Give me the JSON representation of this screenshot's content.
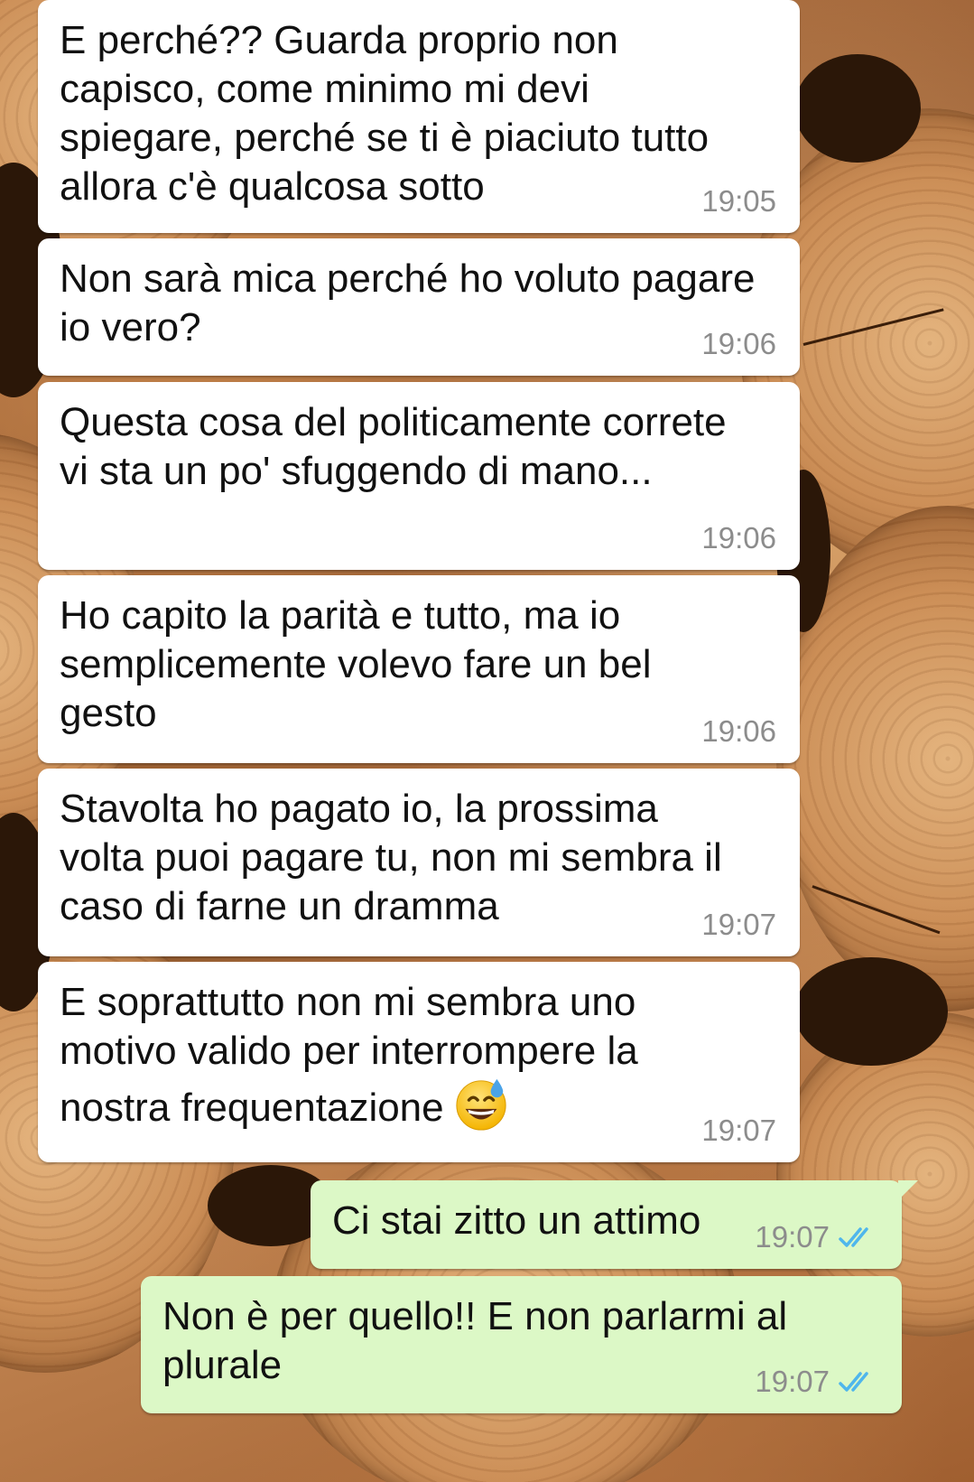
{
  "background": {
    "description_icon": "wood-logs-wallpaper"
  },
  "colors": {
    "incoming_bubble": "#ffffff",
    "outgoing_bubble": "#dcf8c6",
    "timestamp": "#8c8c8c",
    "read_ticks": "#4fb6ec",
    "text": "#111111"
  },
  "messages": [
    {
      "direction": "in",
      "text": "E perché?? Guarda proprio non\ncapisco, come minimo mi devi\nspiegare, perché se ti è piaciuto tutto\nallora c'è qualcosa sotto",
      "time": "19:05"
    },
    {
      "direction": "in",
      "text": "Non sarà mica perché ho voluto pagare\nio vero?",
      "time": "19:06"
    },
    {
      "direction": "in",
      "text": "Questa cosa del politicamente correte\nvi sta un po' sfuggendo di mano...",
      "time": "19:06"
    },
    {
      "direction": "in",
      "text": "Ho capito la parità e tutto, ma io\nsemplicemente volevo fare un bel\ngesto",
      "time": "19:06"
    },
    {
      "direction": "in",
      "text": "Stavolta ho pagato io, la prossima\nvolta puoi pagare tu, non mi sembra il\ncaso di farne un dramma",
      "time": "19:07"
    },
    {
      "direction": "in",
      "text": "E soprattutto non mi sembra uno\nmotivo valido per interrompere la\nnostra frequentazione",
      "emoji": "grinning-face-with-sweat-icon",
      "time": "19:07"
    },
    {
      "direction": "out",
      "text": "Ci stai zitto un attimo",
      "time": "19:07",
      "status": "read-double-check-icon"
    },
    {
      "direction": "out",
      "text": "Non è per quello!! E non parlarmi al\nplurale",
      "time": "19:07",
      "status": "read-double-check-icon"
    }
  ]
}
